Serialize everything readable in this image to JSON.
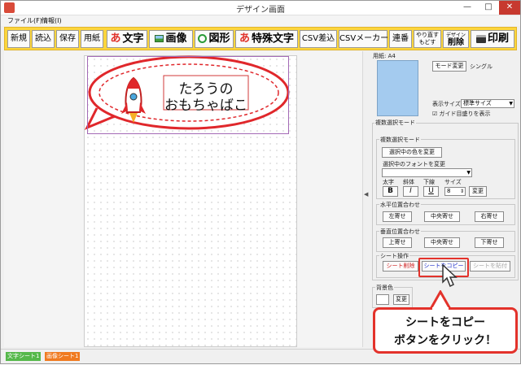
{
  "window": {
    "title": "デザイン画面",
    "min": "—",
    "max": "□",
    "close": "✕"
  },
  "menu": [
    "ファイル(F)",
    "情報(I)"
  ],
  "toolbar": {
    "new": "新規",
    "load": "読込",
    "save": "保存",
    "paper": "用紙",
    "text": "文字",
    "text_icon": "あ",
    "image": "画像",
    "shape": "図形",
    "special_text": "特殊文字",
    "special_icon": "あ",
    "csv_insert": "CSV差込",
    "csv_maker": "CSVメーカー",
    "serial": "連番",
    "redo": "やり直す",
    "undo": "もどす",
    "delete_top": "デザイン",
    "delete": "削除",
    "print": "印刷"
  },
  "design": {
    "line1": "たろうの",
    "line2": "おもちゃばこ"
  },
  "paper_panel": {
    "label": "用紙: A4",
    "mode_change": "モード変更",
    "mode": "シングル",
    "size_label": "表示サイズ",
    "size_value": "標準サイズ",
    "guide": "ガイド目盛りを表示"
  },
  "multi": {
    "title": "複数選択モード",
    "group_title": "複数選択モード",
    "change_color": "選択中の色を変更",
    "font_label": "選択中のフォントを変更",
    "bold_lbl": "太字",
    "italic_lbl": "斜体",
    "underline_lbl": "下線",
    "size_lbl": "サイズ",
    "b": "B",
    "i": "I",
    "u": "U",
    "size_value": "8",
    "change": "変更",
    "h_align": "水平位置合わせ",
    "left": "左寄せ",
    "center": "中央寄せ",
    "right": "右寄せ",
    "v_align": "垂直位置合わせ",
    "top": "上寄せ",
    "middle": "中央寄せ",
    "bottom": "下寄せ",
    "sheet_ops": "シート操作",
    "sheet_delete": "シート削除",
    "sheet_copy": "シートをコピー",
    "sheet_paste": "シートを貼付"
  },
  "bg": {
    "title": "背景色",
    "change": "変更"
  },
  "tabs": [
    {
      "label": "文字シート1",
      "color": "#55b84a"
    },
    {
      "label": "画像シート1",
      "color": "#f07a20"
    }
  ],
  "callout": {
    "line1": "シートをコピー",
    "line2": "ボタンをクリック！"
  },
  "colors": {
    "toolbar": "#fcd53c",
    "accent_red": "#e3322b",
    "paper_thumb": "#a4cbef"
  }
}
